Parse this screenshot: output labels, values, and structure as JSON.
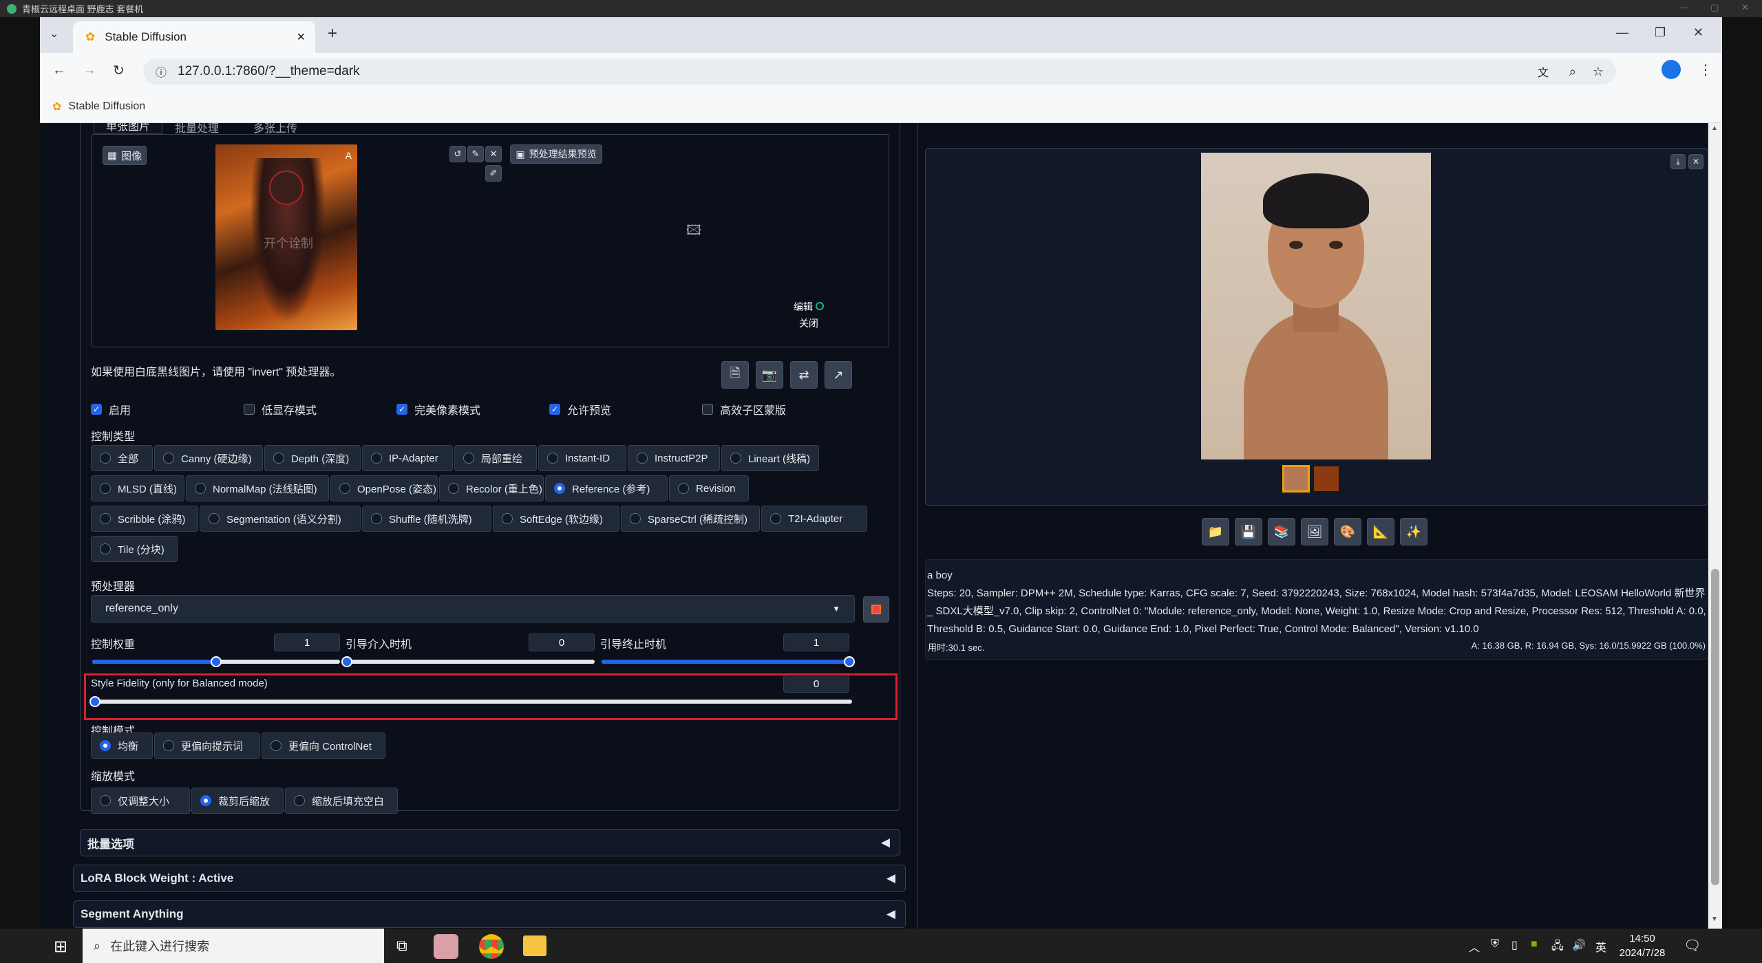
{
  "remote_desktop": {
    "title": "青椒云远程桌面 野鹿志 套餐机"
  },
  "browser": {
    "tab_title": "Stable Diffusion",
    "url": "127.0.0.1:7860/?__theme=dark",
    "bookmark": "Stable Diffusion"
  },
  "left": {
    "subtabs": [
      "单张图片",
      "批量处理",
      "多张上传"
    ],
    "image_label": "图像",
    "preview_btn": "预处理结果预览",
    "edit_label": "编辑",
    "close_label": "关闭",
    "watermark": "开个诠制",
    "hint": "如果使用白底黑线图片，请使用 \"invert\" 预处理器。",
    "checks": [
      {
        "label": "启用",
        "on": true
      },
      {
        "label": "低显存模式",
        "on": false
      },
      {
        "label": "完美像素模式",
        "on": true
      },
      {
        "label": "允许预览",
        "on": true
      },
      {
        "label": "高效子区蒙版",
        "on": false
      }
    ],
    "control_type_label": "控制类型",
    "control_types": [
      "全部",
      "Canny (硬边缘)",
      "Depth (深度)",
      "IP-Adapter",
      "局部重绘",
      "Instant-ID",
      "InstructP2P",
      "Lineart (线稿)",
      "MLSD (直线)",
      "NormalMap (法线贴图)",
      "OpenPose (姿态)",
      "Recolor (重上色)",
      "Reference (参考)",
      "Revision",
      "Scribble (涂鸦)",
      "Segmentation (语义分割)",
      "Shuffle (随机洗牌)",
      "SoftEdge (软边缘)",
      "SparseCtrl (稀疏控制)",
      "T2I-Adapter",
      "Tile (分块)"
    ],
    "preprocessor_label": "预处理器",
    "preprocessor_value": "reference_only",
    "weight_label": "控制权重",
    "weight_value": "1",
    "start_label": "引导介入时机",
    "start_value": "0",
    "end_label": "引导终止时机",
    "end_value": "1",
    "style_fidelity_label": "Style Fidelity (only for Balanced mode)",
    "style_fidelity_value": "0",
    "control_mode_label": "控制模式",
    "control_modes": [
      "均衡",
      "更偏向提示词",
      "更偏向 ControlNet"
    ],
    "resize_mode_label": "缩放模式",
    "resize_modes": [
      "仅调整大小",
      "裁剪后缩放",
      "缩放后填充空白"
    ],
    "batch_options": "批量选项",
    "lora_block": "LoRA Block Weight : Active",
    "segment_anything": "Segment Anything"
  },
  "right": {
    "prompt": "a boy",
    "info": "Steps: 20, Sampler: DPM++ 2M, Schedule type: Karras, CFG scale: 7, Seed: 3792220243, Size: 768x1024, Model hash: 573f4a7d35, Model: LEOSAM HelloWorld 新世界 _ SDXL大模型_v7.0, Clip skip: 2, ControlNet 0: \"Module: reference_only, Model: None, Weight: 1.0, Resize Mode: Crop and Resize, Processor Res: 512, Threshold A: 0.0, Threshold B: 0.5, Guidance Start: 0.0, Guidance End: 1.0, Pixel Perfect: True, Control Mode: Balanced\", Version: v1.10.0",
    "time": "用时:30.1 sec.",
    "mem": "A: 16.38 GB, R: 16.94 GB, Sys: 16.0/15.9922 GB (100.0%)"
  },
  "taskbar": {
    "search_placeholder": "在此键入进行搜索",
    "ime": "英",
    "time": "14:50",
    "date": "2024/7/28"
  }
}
